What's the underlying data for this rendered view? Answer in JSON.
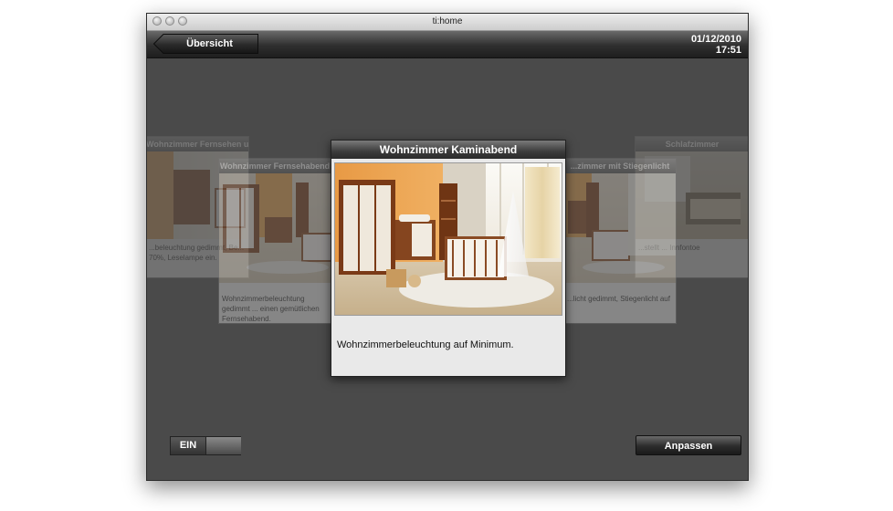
{
  "window": {
    "title": "ti:home"
  },
  "toolbar": {
    "back_label": "Übersicht",
    "date": "01/12/2010",
    "time": "17:51"
  },
  "scenes": {
    "far_left": {
      "title": "Wohnzimmer Fernsehen u. Lesen",
      "description": "...beleuchtung gedimmt, Be... 70%, Leselampe ein."
    },
    "left": {
      "title": "Wohnzimmer Fernsehabend",
      "description": "Wohnzimmerbeleuchtung gedimmt ... einen gemütlichen Fernsehabend."
    },
    "center": {
      "title": "Wohnzimmer Kaminabend",
      "description": "Wohnzimmerbeleuchtung auf Minimum."
    },
    "right": {
      "title": "...zimmer mit Stiegenlicht",
      "description": "...licht gedimmt, Stiegenlicht auf"
    },
    "far_right": {
      "title": "Schlafzimmer",
      "description": "...stellt ... Innfontoe"
    }
  },
  "controls": {
    "toggle_label": "EIN",
    "adjust_label": "Anpassen"
  },
  "icons": {
    "back": "back-arrow-icon"
  },
  "colors": {
    "background": "#4a4a4a",
    "card": "#e9e9e9",
    "toolbar_dark": "#1e1e1e"
  }
}
